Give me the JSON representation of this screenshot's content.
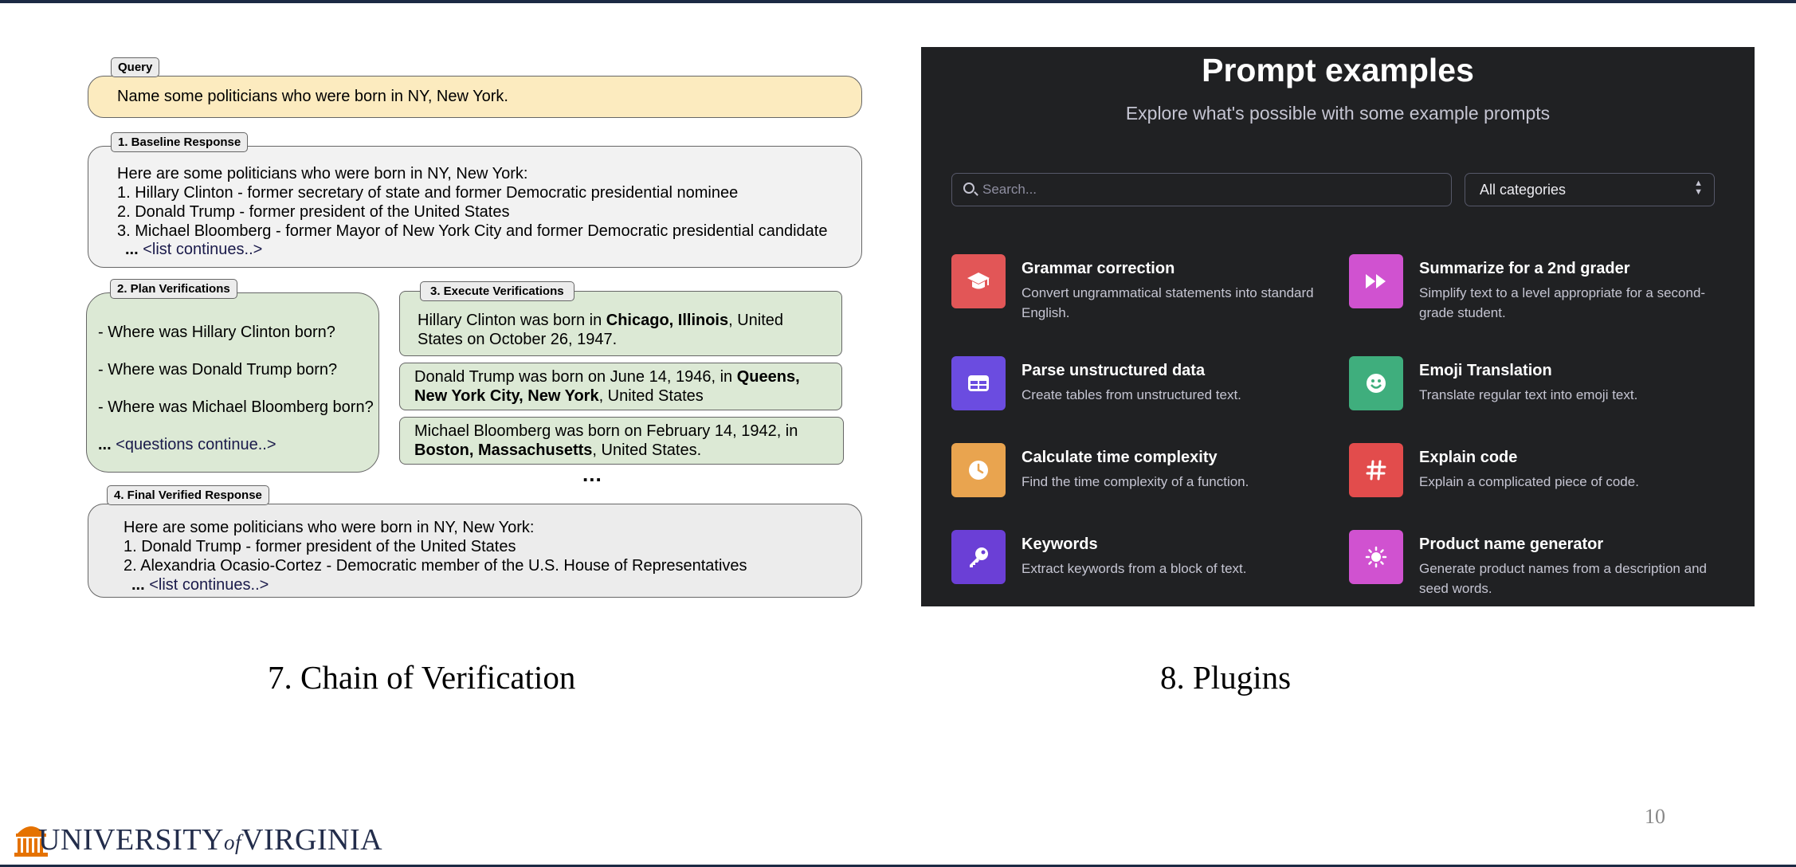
{
  "slide": {
    "page_number": "10",
    "logo": {
      "name": "UNIVERSITY of VIRGINIA",
      "part1": "UNIVERSITY",
      "part2": "of",
      "part3": "VIRGINIA"
    }
  },
  "cove": {
    "caption": "7. Chain of Verification",
    "query": {
      "tag": "Query",
      "text": "Name some politicians who were born in NY, New York."
    },
    "baseline": {
      "tag": "1. Baseline Response",
      "lines": [
        "Here are some politicians who were born in NY, New York:",
        "1. Hillary Clinton - former secretary of state and former Democratic presidential nominee",
        "2. Donald Trump - former president of the United States",
        "3. Michael Bloomberg - former Mayor of New York City and former Democratic presidential candidate"
      ],
      "ellipsis": "...",
      "continues": "<list continues..>"
    },
    "plan": {
      "tag": "2. Plan Verifications",
      "questions": [
        "- Where was Hillary Clinton born?",
        "- Where was Donald Trump born?",
        "- Where was Michael Bloomberg born?"
      ],
      "ellipsis": "...",
      "continues": "<questions continue..>"
    },
    "execute": {
      "tag": "3. Execute Verifications",
      "answers": [
        {
          "pre": "Hillary Clinton was born in ",
          "bold": "Chicago, Illinois",
          "post": ", United States on October 26, 1947."
        },
        {
          "pre": "Donald Trump was born on June 14, 1946, in ",
          "bold": "Queens, New York City, New York",
          "post": ", United States"
        },
        {
          "pre": "Michael Bloomberg was born on February 14, 1942, in ",
          "bold": "Boston, Massachusetts",
          "post": ", United States."
        }
      ],
      "more": "..."
    },
    "final": {
      "tag": "4. Final Verified Response",
      "lines": [
        "Here are some politicians who were born in NY, New York:",
        "1. Donald Trump - former president of the United States",
        "2. Alexandria Ocasio-Cortez - Democratic member of the U.S. House of Representatives"
      ],
      "ellipsis": "...",
      "continues": "<list continues..>"
    }
  },
  "plugins": {
    "caption": "8. Plugins",
    "title": "Prompt examples",
    "subtitle": "Explore what's possible with some example prompts",
    "search_placeholder": "Search...",
    "category_select": "All categories",
    "cards": [
      {
        "title": "Grammar correction",
        "desc": "Convert ungrammatical statements into standard English.",
        "icon": "graduation-cap-icon",
        "color": "#e25657"
      },
      {
        "title": "Summarize for a 2nd grader",
        "desc": "Simplify text to a level appropriate for a second-grade student.",
        "icon": "fast-forward-icon",
        "color": "#d052d0"
      },
      {
        "title": "Parse unstructured data",
        "desc": "Create tables from unstructured text.",
        "icon": "table-icon",
        "color": "#6b4ce0"
      },
      {
        "title": "Emoji Translation",
        "desc": "Translate regular text into emoji text.",
        "icon": "smiley-icon",
        "color": "#3fae7d"
      },
      {
        "title": "Calculate time complexity",
        "desc": "Find the time complexity of a function.",
        "icon": "clock-icon",
        "color": "#e9a44f"
      },
      {
        "title": "Explain code",
        "desc": "Explain a complicated piece of code.",
        "icon": "hashtag-icon",
        "color": "#e24c4c"
      },
      {
        "title": "Keywords",
        "desc": "Extract keywords from a block of text.",
        "icon": "key-icon",
        "color": "#6b3fd6"
      },
      {
        "title": "Product name generator",
        "desc": "Generate product names from a description and seed words.",
        "icon": "lightbulb-icon",
        "color": "#d052d0"
      }
    ]
  }
}
